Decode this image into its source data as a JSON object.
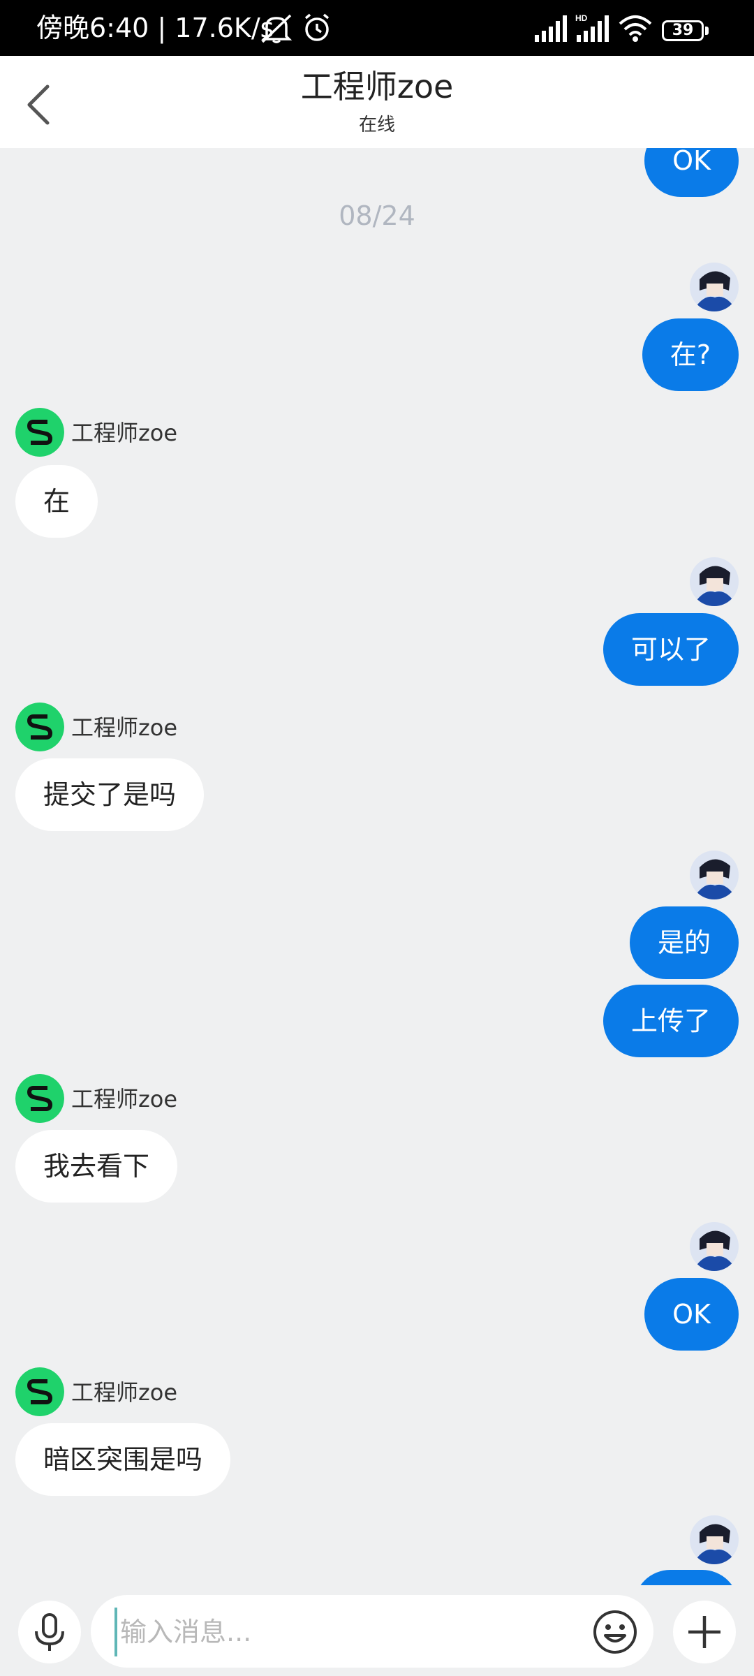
{
  "status_bar": {
    "time_text": "傍晚6:40 | 17.6K/s",
    "battery": "39"
  },
  "header": {
    "title": "工程师zoe",
    "subtitle": "在线"
  },
  "chat": {
    "top_partial_text": "OK",
    "date_label": "08/24",
    "contact_name": "工程师zoe",
    "messages": [
      {
        "from": "me",
        "text": "在?"
      },
      {
        "from": "them",
        "text": "在"
      },
      {
        "from": "me",
        "text": "可以了"
      },
      {
        "from": "them",
        "text": "提交了是吗"
      },
      {
        "from": "me",
        "text": "是的"
      },
      {
        "from": "me",
        "text": "上传了"
      },
      {
        "from": "them",
        "text": "我去看下"
      },
      {
        "from": "me",
        "text": "OK"
      },
      {
        "from": "them",
        "text": "暗区突围是吗"
      }
    ]
  },
  "input_bar": {
    "placeholder": "输入消息..."
  },
  "colors": {
    "accent": "#0a7be8",
    "background": "#eff0f1",
    "contact_avatar": "#1fd26b"
  }
}
